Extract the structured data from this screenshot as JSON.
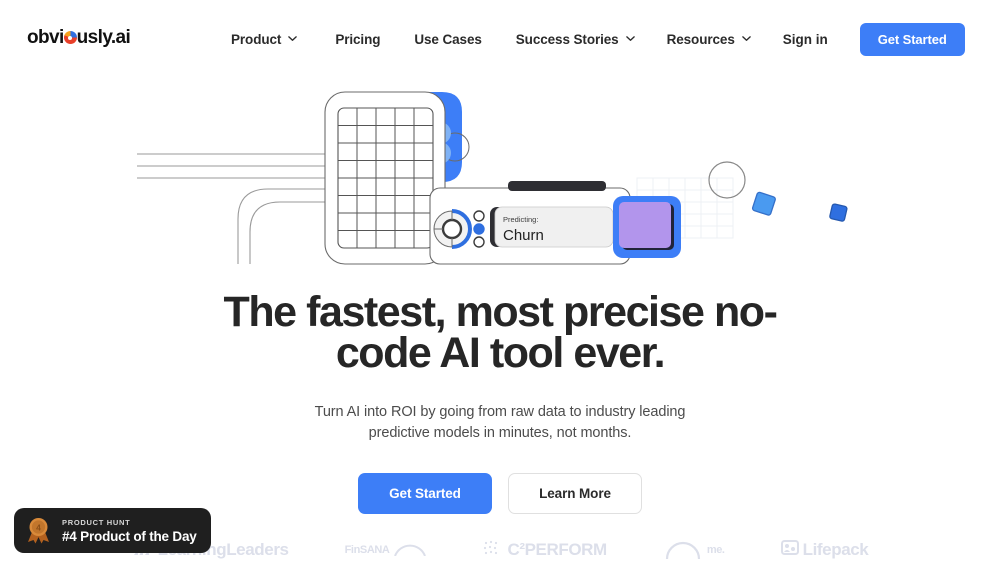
{
  "brand": {
    "text_before": "obvi",
    "text_after": "usly.ai",
    "logo_icon": "pie-chart-o-icon",
    "colors": [
      "#e8402a",
      "#f6a21e",
      "#2f6fe0"
    ]
  },
  "nav": {
    "items": [
      {
        "label": "Product",
        "has_dropdown": true,
        "icon": "chevron-down-icon"
      },
      {
        "label": "Pricing",
        "has_dropdown": false
      },
      {
        "label": "Use Cases",
        "has_dropdown": false
      },
      {
        "label": "Success Stories",
        "has_dropdown": true,
        "icon": "chevron-down-icon"
      },
      {
        "label": "Resources",
        "has_dropdown": true,
        "icon": "chevron-down-icon"
      }
    ],
    "signin_label": "Sign in",
    "cta_label": "Get Started"
  },
  "illustration": {
    "name": "no-code-ai-device-illustration",
    "predicting_label": "Predicting:",
    "predicting_value": "Churn",
    "accent_blue": "#3d7ef7",
    "light_blue": "#7fb2f5",
    "purple": "#b295ec",
    "dark": "#2e2e33"
  },
  "hero": {
    "headline": "The fastest, most precise no-code AI tool ever.",
    "subheadline": "Turn AI into ROI by going from raw data to industry leading predictive models in minutes, not months.",
    "primary_cta": "Get Started",
    "secondary_cta": "Learn More"
  },
  "product_hunt": {
    "kicker": "PRODUCT HUNT",
    "title": "#4 Product of the Day",
    "rank": "4",
    "icon": "medal-icon",
    "background": "#1f1f1f"
  },
  "clients": [
    {
      "name": "LearningLeaders",
      "mark": "people-icon"
    },
    {
      "name": "FinSANA",
      "mark": "arc-icon"
    },
    {
      "name": "C2PERFORM",
      "display": "C²PERFORM",
      "mark": "dots-icon"
    },
    {
      "name": "me.",
      "mark": "arc-circle-icon"
    },
    {
      "name": "Lifepack",
      "mark": "box-icon"
    }
  ]
}
